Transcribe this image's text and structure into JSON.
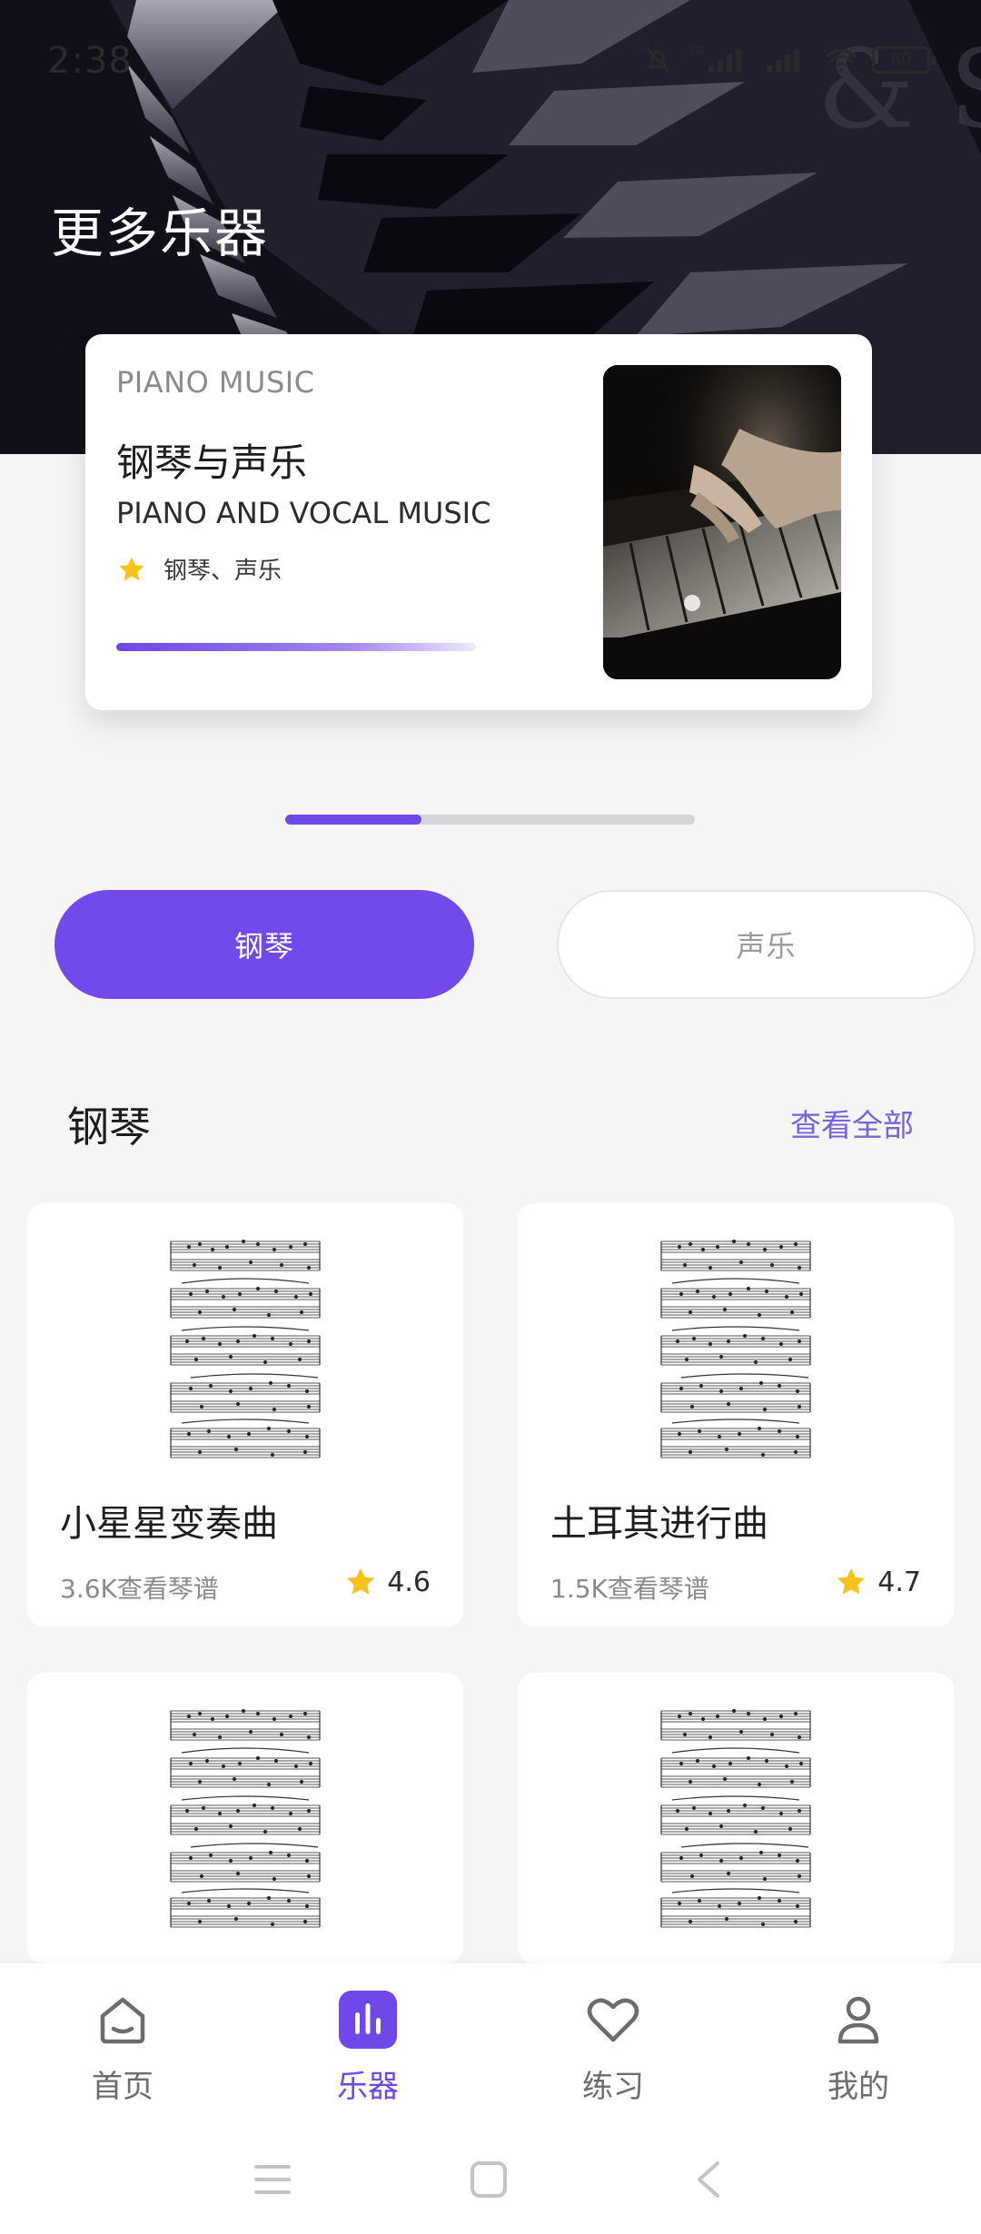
{
  "status_bar": {
    "time": "2:38",
    "network_label": "5G",
    "battery_level": "80"
  },
  "hero": {
    "title": "更多乐器"
  },
  "featured": {
    "eyebrow": "PIANO MUSIC",
    "title": "钢琴与声乐",
    "subtitle": "PIANO AND VOCAL MUSIC",
    "tags": "钢琴、声乐",
    "tag_icon": "star-icon",
    "progress_fraction": 1.0
  },
  "pager": {
    "page_count": 3,
    "current_page": 1
  },
  "segments": {
    "active": "钢琴",
    "inactive": "声乐"
  },
  "section": {
    "title": "钢琴",
    "view_all": "查看全部"
  },
  "scores": [
    {
      "title": "小星星变奏曲",
      "views": "3.6K查看琴谱",
      "rating": "4.6"
    },
    {
      "title": "土耳其进行曲",
      "views": "1.5K查看琴谱",
      "rating": "4.7"
    },
    {
      "title": "",
      "views": "",
      "rating": ""
    },
    {
      "title": "",
      "views": "",
      "rating": ""
    }
  ],
  "nav": {
    "items": [
      {
        "label": "首页",
        "icon": "home-icon"
      },
      {
        "label": "乐器",
        "icon": "instruments-icon",
        "active": true
      },
      {
        "label": "练习",
        "icon": "heart-icon"
      },
      {
        "label": "我的",
        "icon": "profile-icon"
      }
    ]
  },
  "colors": {
    "accent": "#7249ea",
    "star": "#f7c21a",
    "link": "#7a63d6"
  }
}
